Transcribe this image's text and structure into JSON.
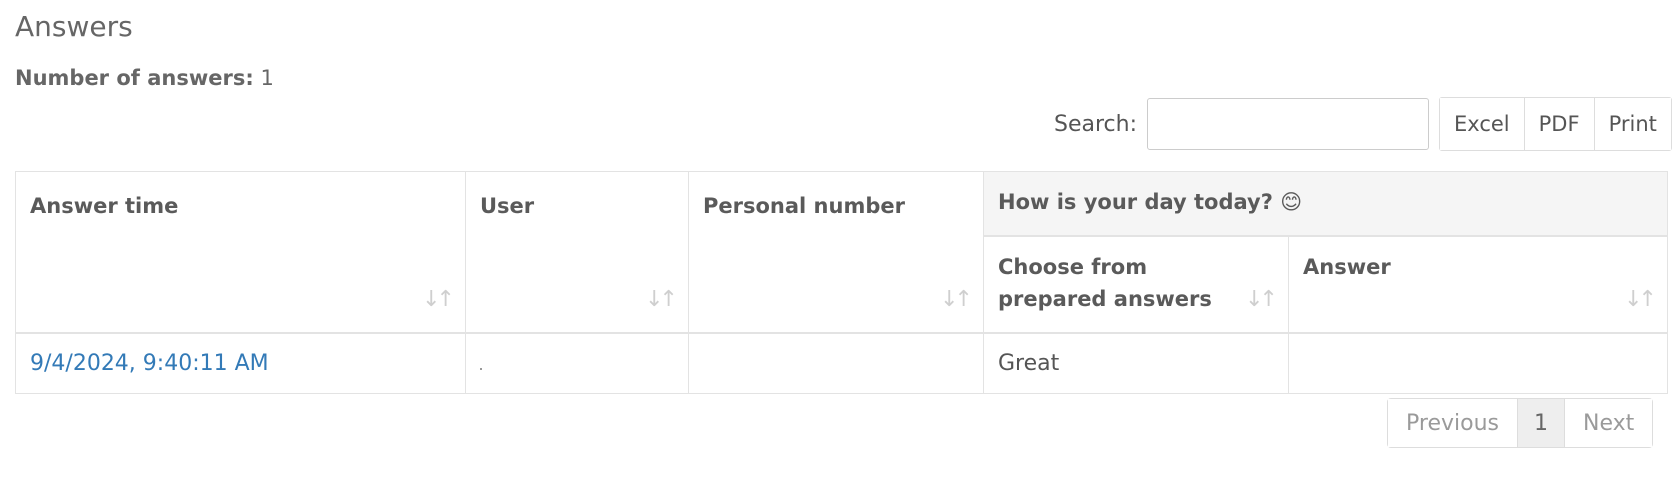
{
  "page": {
    "title": "Answers",
    "count_label": "Number of answers:",
    "count_value": "1"
  },
  "search": {
    "label": "Search:",
    "value": "",
    "placeholder": ""
  },
  "export_buttons": [
    "Excel",
    "PDF",
    "Print"
  ],
  "table": {
    "columns": {
      "answer_time": "Answer time",
      "user": "User",
      "personal_number": "Personal number",
      "question_group": "How is your day today? 😊",
      "choose_prepared": "Choose from prepared answers",
      "answer": "Answer"
    },
    "sort_icon": "sort-arrows-icon",
    "rows": [
      {
        "answer_time": "9/4/2024, 9:40:11 AM",
        "user": "",
        "personal_number": "",
        "choose_prepared": "Great",
        "answer": ""
      }
    ]
  },
  "pagination": {
    "previous": "Previous",
    "current": "1",
    "next": "Next"
  },
  "colors": {
    "link": "#337ab7",
    "header_group_bg": "#f5f5f5",
    "border": "#e3e3e3"
  }
}
